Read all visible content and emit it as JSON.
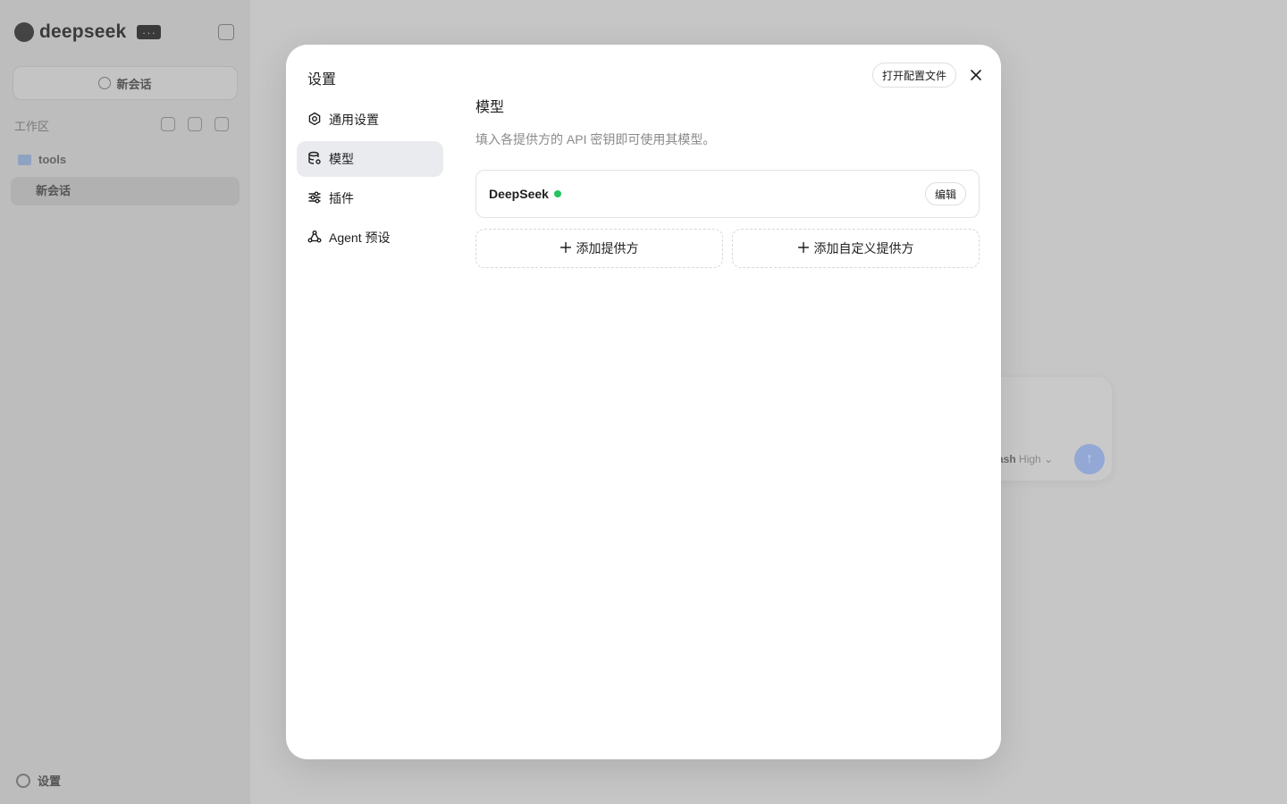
{
  "sidebar": {
    "brand": "deepseek",
    "badge": "...",
    "new_chat_label": "新会话",
    "workspace_label": "工作区",
    "folder_name": "tools",
    "session_label": "新会话",
    "settings_label": "设置"
  },
  "composer": {
    "model_label": "ash",
    "effort_label": "High"
  },
  "modal": {
    "title": "设置",
    "open_config_label": "打开配置文件",
    "nav": [
      {
        "label": "通用设置",
        "icon": "gear-icon"
      },
      {
        "label": "模型",
        "icon": "database-icon",
        "active": true
      },
      {
        "label": "插件",
        "icon": "sliders-icon"
      },
      {
        "label": "Agent 预设",
        "icon": "agent-icon"
      }
    ],
    "section": {
      "title": "模型",
      "description": "填入各提供方的 API 密钥即可使用其模型。",
      "providers": [
        {
          "name": "DeepSeek",
          "status_color": "#22c55e",
          "edit_label": "编辑"
        }
      ],
      "add_provider_label": "添加提供方",
      "add_custom_provider_label": "添加自定义提供方"
    }
  }
}
